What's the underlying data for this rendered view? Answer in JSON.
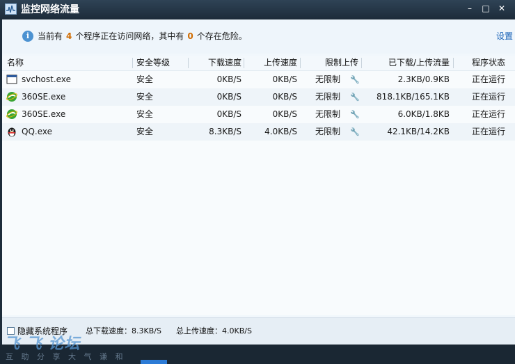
{
  "window": {
    "title": "监控网络流量",
    "min_glyph": "–",
    "max_glyph": "□",
    "close_glyph": "✕"
  },
  "info": {
    "icon_glyph": "i",
    "prefix": "当前有",
    "program_count": "4",
    "middle": "个程序正在访问网络，其中有",
    "danger_count": "0",
    "suffix": "个存在危险。",
    "settings_label": "设置"
  },
  "table": {
    "columns": [
      "名称",
      "安全等级",
      "下载速度",
      "上传速度",
      "限制上传",
      "已下载/上传流量",
      "程序状态"
    ],
    "rows": [
      {
        "icon": "window-app-icon",
        "name": "svchost.exe",
        "security": "安全",
        "download": "0KB/S",
        "upload": "0KB/S",
        "limit": "无限制",
        "traffic": "2.3KB/0.9KB",
        "status": "正在运行"
      },
      {
        "icon": "browser-360se-icon",
        "name": "360SE.exe",
        "security": "安全",
        "download": "0KB/S",
        "upload": "0KB/S",
        "limit": "无限制",
        "traffic": "818.1KB/165.1KB",
        "status": "正在运行"
      },
      {
        "icon": "browser-360se-icon",
        "name": "360SE.exe",
        "security": "安全",
        "download": "0KB/S",
        "upload": "0KB/S",
        "limit": "无限制",
        "traffic": "6.0KB/1.8KB",
        "status": "正在运行"
      },
      {
        "icon": "qq-penguin-icon",
        "name": "QQ.exe",
        "security": "安全",
        "download": "8.3KB/S",
        "upload": "4.0KB/S",
        "limit": "无限制",
        "traffic": "42.1KB/14.2KB",
        "status": "正在运行"
      }
    ]
  },
  "footer": {
    "hide_system_label": "隐藏系统程序",
    "total_download": "总下载速度：8.3KB/S",
    "total_upload": "总上传速度：4.0KB/S"
  },
  "watermark": {
    "logo": "飞 飞 论坛",
    "slogan": "互 助 分 享   大 气 谦 和"
  },
  "colors": {
    "accent": "#d06b00",
    "link": "#1560b6",
    "titlebar": "#1c2b39"
  }
}
